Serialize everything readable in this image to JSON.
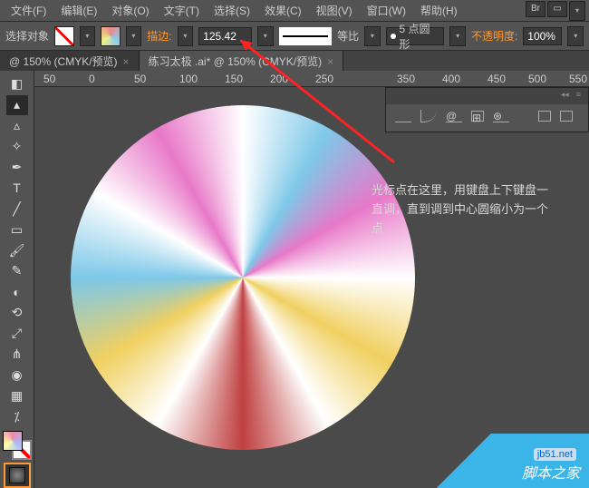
{
  "menu": {
    "file": "文件(F)",
    "edit": "编辑(E)",
    "object": "对象(O)",
    "type": "文字(T)",
    "select": "选择(S)",
    "effect": "效果(C)",
    "view": "视图(V)",
    "window": "窗口(W)",
    "help": "帮助(H)",
    "br": "Br"
  },
  "options": {
    "select_label": "选择对象",
    "stroke_label": "描边:",
    "stroke_weight": "125.42",
    "profile_label": "等比",
    "brush_label": "5 点圆形",
    "opacity_label": "不透明度:",
    "opacity_value": "100%"
  },
  "tabs": {
    "tab1": "@ 150% (CMYK/预览)",
    "tab2": "练习太极     .ai* @ 150% (CMYK/预览)"
  },
  "ruler": {
    "m50": "50",
    "p0": "0",
    "p50": "50",
    "p100": "100",
    "p150": "150",
    "p200": "200",
    "p250": "250",
    "p350": "350",
    "p400": "400",
    "p450": "450",
    "p500": "500",
    "p550": "550"
  },
  "annotation": {
    "text": "光标点在这里，用键盘上下键盘一直调，直到调到中心圆缩小为一个点"
  },
  "watermark": {
    "site": "脚本之家",
    "url": "jb51.net"
  }
}
